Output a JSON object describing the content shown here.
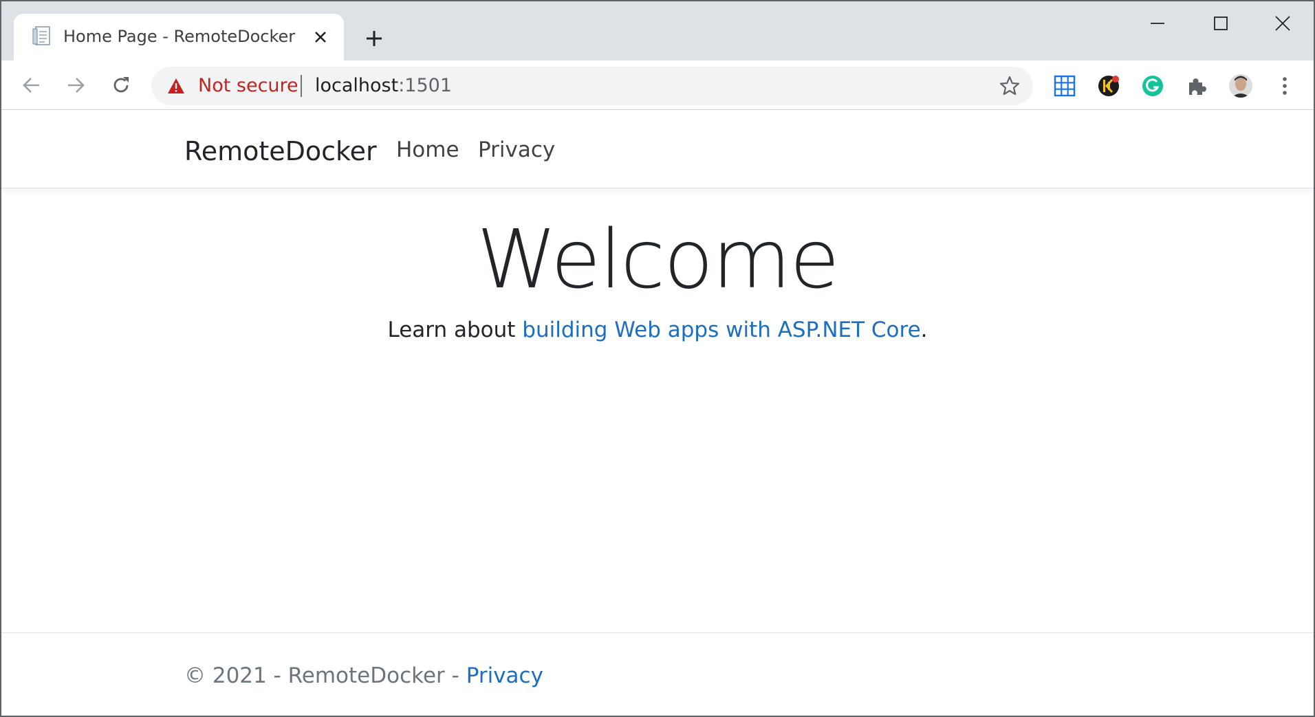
{
  "browser": {
    "tab": {
      "title": "Home Page - RemoteDocker"
    },
    "omnibox": {
      "security_label": "Not secure",
      "host": "localhost",
      "port": ":1501"
    }
  },
  "site": {
    "brand": "RemoteDocker",
    "nav": {
      "home": "Home",
      "privacy": "Privacy"
    },
    "main": {
      "heading": "Welcome",
      "learn_prefix": "Learn about ",
      "learn_link": "building Web apps with ASP.NET Core",
      "learn_suffix": "."
    },
    "footer": {
      "copyright": "© 2021 - RemoteDocker - ",
      "privacy_link": "Privacy"
    }
  },
  "colors": {
    "link": "#1b6ec2",
    "warning": "#c5221f",
    "tabstrip": "#dee1e6"
  }
}
